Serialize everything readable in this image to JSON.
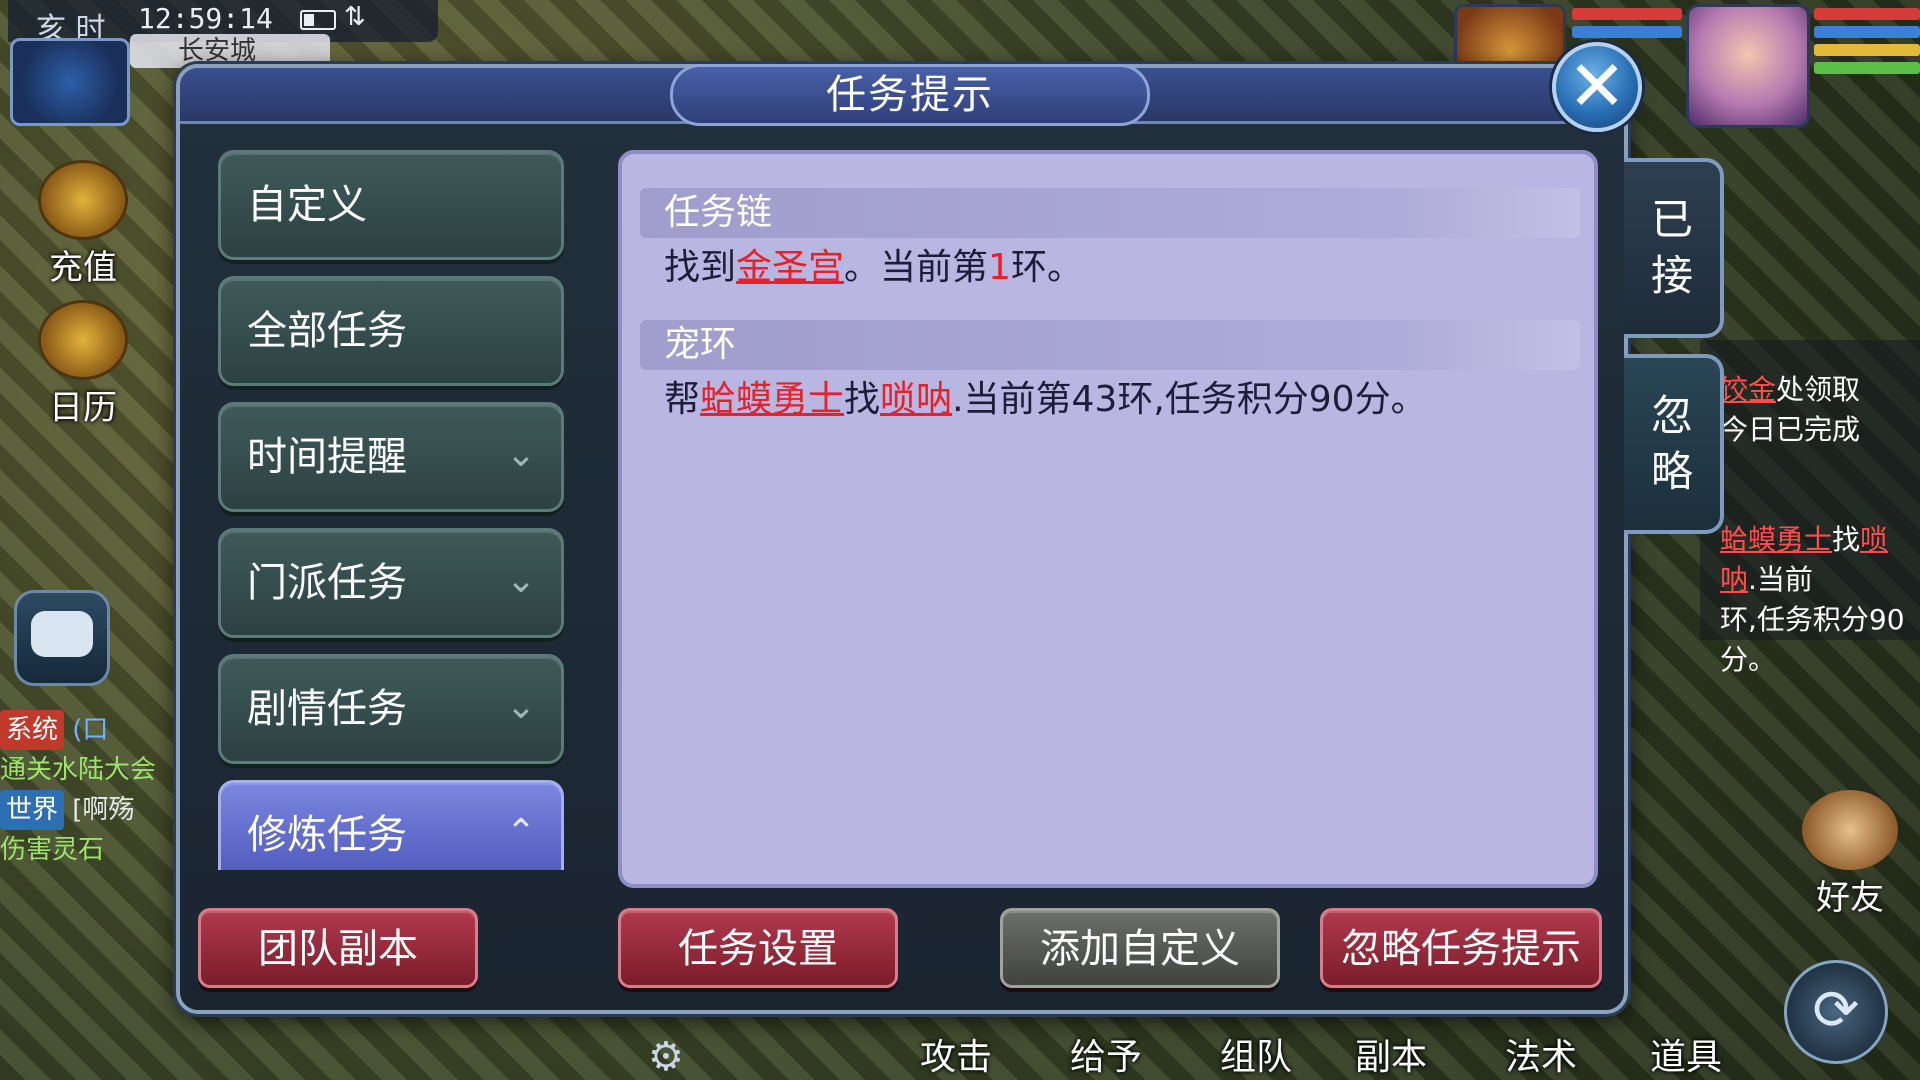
{
  "hud": {
    "shichen": "亥 时",
    "clock": "12:59:14",
    "map_name": "长安城",
    "recharge_label": "充值",
    "calendar_label": "日历",
    "chat": [
      {
        "tag": "系统",
        "tag_color": "#c0392b",
        "text": "(口"
      },
      {
        "tag": "",
        "tag_color": "",
        "text": "通关水陆大会"
      },
      {
        "tag": "世界",
        "tag_color": "#2e6fb4",
        "text": "[啊殇"
      },
      {
        "tag": "",
        "tag_color": "",
        "text": "伤害灵石"
      }
    ],
    "side_task": {
      "line1_link": "饺金",
      "line1_text": "处领取",
      "line2": "今日已完成",
      "line3_link1": "蛤蟆勇士",
      "line3_mid": "找",
      "line3_link2": "唢呐",
      "line3_end": ".当前",
      "line4": "环,任务积分90分。"
    },
    "friends_label": "好友",
    "bottom_bar": [
      "攻击",
      "给予",
      "组队",
      "副本",
      "法术",
      "道具"
    ]
  },
  "dialog": {
    "title": "任务提示",
    "close_symbol": "✕",
    "nav": [
      {
        "label": "自定义",
        "chevron": "",
        "active": false
      },
      {
        "label": "全部任务",
        "chevron": "",
        "active": false
      },
      {
        "label": "时间提醒",
        "chevron": "⌄",
        "active": false
      },
      {
        "label": "门派任务",
        "chevron": "⌄",
        "active": false
      },
      {
        "label": "剧情任务",
        "chevron": "⌄",
        "active": false
      },
      {
        "label": "修炼任务",
        "chevron": "⌃",
        "active": true
      }
    ],
    "tasks": [
      {
        "title": "任务链",
        "pre": "找到",
        "link": "金圣宫",
        "mid": "。当前第",
        "num": "1",
        "post": "环。"
      },
      {
        "title": "宠环",
        "pre": "帮",
        "link1": "蛤蟆勇士",
        "mid1": "找",
        "link2": "唢呐",
        "post": ".当前第43环,任务积分90分。"
      }
    ],
    "side_tabs": {
      "accepted": [
        "已",
        "接"
      ],
      "ignore": [
        "忽",
        "略"
      ]
    },
    "buttons": {
      "team_dungeon": "团队副本",
      "task_settings": "任务设置",
      "add_custom": "添加自定义",
      "ignore_prompt": "忽略任务提示"
    },
    "colors": {
      "link": "#e8202a",
      "active_tab": "#6470d0",
      "content_bg": "#b9b7e1"
    }
  }
}
